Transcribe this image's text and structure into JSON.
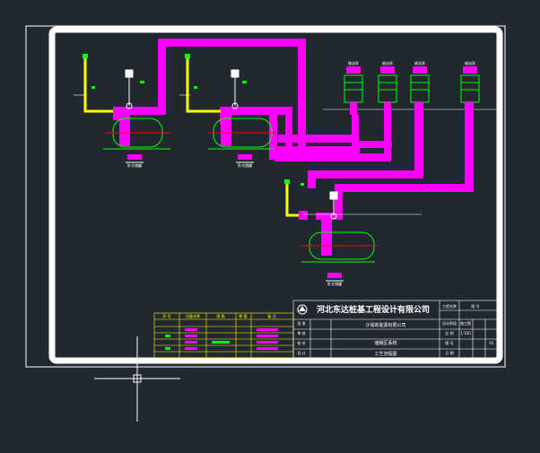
{
  "title_block": {
    "company": "河北东达桩基工程设计有限公司",
    "project_client": "沙易新能源有限公司",
    "drawing_category": "储罐区系统",
    "drawing_title": "工艺流程图",
    "sheet_label": "图 号",
    "left_labels": [
      "批 准",
      "审 核",
      "校 对",
      "设 计",
      "制 图"
    ],
    "right_labels": [
      "工程名称",
      "设计阶段",
      "比 例",
      "图 号",
      "日 期"
    ],
    "right_values": [
      "施工图",
      "1:100",
      "",
      "01"
    ]
  },
  "legend_table": {
    "headers": [
      "序 号",
      "设备名称",
      "规 格",
      "数 量",
      "备 注"
    ]
  },
  "tank_labels": [
    "卧式储罐",
    "卧式储罐",
    "卧式储罐"
  ],
  "pump_labels": [
    "输油泵",
    "输油泵",
    "输油泵",
    "输油泵"
  ],
  "colors": {
    "background": "#212830",
    "drawing_border": "#ffffff",
    "pipe": "#ff00ff",
    "vent_pipe": "#ffff00",
    "pump_body": "#00ff00",
    "tank_outline": "#00ff00",
    "tank_axis": "#ff0000",
    "crosshair": "#ffffff"
  }
}
